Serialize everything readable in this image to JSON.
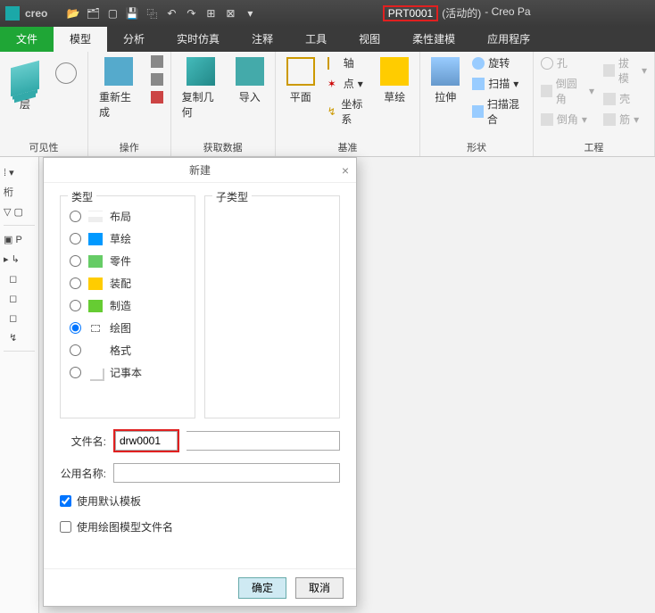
{
  "titlebar": {
    "brand": "creo",
    "doc": "PRT0001",
    "status": "(活动的)",
    "app": "- Creo Pa"
  },
  "tabs": {
    "file": "文件",
    "model": "模型",
    "analysis": "分析",
    "realtime": "实时仿真",
    "annotate": "注释",
    "tools": "工具",
    "view": "视图",
    "flex": "柔性建模",
    "apps": "应用程序"
  },
  "ribbon": {
    "layers": "层",
    "visibility": "可见性",
    "regen": "重新生成",
    "operate": "操作",
    "copygeom": "复制几何",
    "import": "导入",
    "getdata": "获取数据",
    "plane": "平面",
    "axis": "轴",
    "point": "点",
    "csys": "坐标系",
    "datum": "基准",
    "sketch": "草绘",
    "extrude": "拉伸",
    "revolve": "旋转",
    "sweep": "扫描",
    "blend": "扫描混合",
    "shapes": "形状",
    "hole": "孔",
    "draft": "拔模",
    "round": "倒圆角",
    "shell": "壳",
    "chamfer": "倒角",
    "rib": "筋",
    "engineering": "工程"
  },
  "dialog": {
    "title": "新建",
    "type_legend": "类型",
    "subtype_legend": "子类型",
    "types": {
      "layout": "布局",
      "sketch": "草绘",
      "part": "零件",
      "asm": "装配",
      "mfg": "制造",
      "drawing": "绘图",
      "format": "格式",
      "notebook": "记事本"
    },
    "filename_label": "文件名:",
    "filename_value": "drw0001",
    "common_label": "公用名称:",
    "common_value": "",
    "use_default_template": "使用默认模板",
    "use_drawing_model_filename": "使用绘图模型文件名",
    "ok": "确定",
    "cancel": "取消"
  }
}
